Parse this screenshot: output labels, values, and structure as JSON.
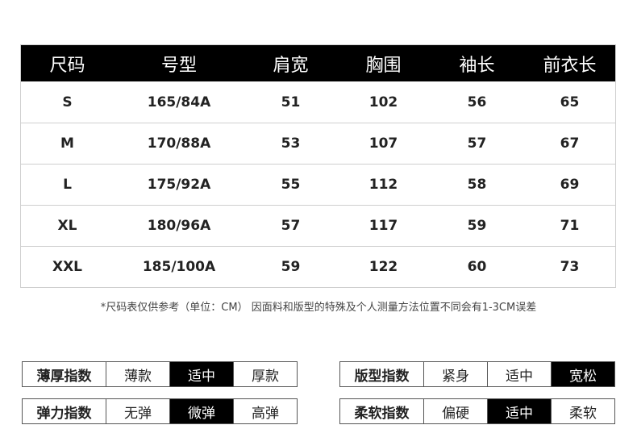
{
  "table": {
    "headers": [
      "尺码",
      "号型",
      "肩宽",
      "胸围",
      "袖长",
      "前衣长"
    ],
    "rows": [
      [
        "S",
        "165/84A",
        "51",
        "102",
        "56",
        "65"
      ],
      [
        "M",
        "170/88A",
        "53",
        "107",
        "57",
        "67"
      ],
      [
        "L",
        "175/92A",
        "55",
        "112",
        "58",
        "69"
      ],
      [
        "XL",
        "180/96A",
        "57",
        "117",
        "59",
        "71"
      ],
      [
        "XXL",
        "185/100A",
        "59",
        "122",
        "60",
        "73"
      ]
    ]
  },
  "note": "*尺码表仅供参考（单位：CM） 因面料和版型的特殊及个人测量方法位置不同会有1-3CM误差",
  "indices": [
    {
      "label": "薄厚指数",
      "options": [
        "薄款",
        "适中",
        "厚款"
      ],
      "selected": 1
    },
    {
      "label": "版型指数",
      "options": [
        "紧身",
        "适中",
        "宽松"
      ],
      "selected": 2
    },
    {
      "label": "弹力指数",
      "options": [
        "无弹",
        "微弹",
        "高弹"
      ],
      "selected": 1
    },
    {
      "label": "柔软指数",
      "options": [
        "偏硬",
        "适中",
        "柔软"
      ],
      "selected": 1
    }
  ]
}
